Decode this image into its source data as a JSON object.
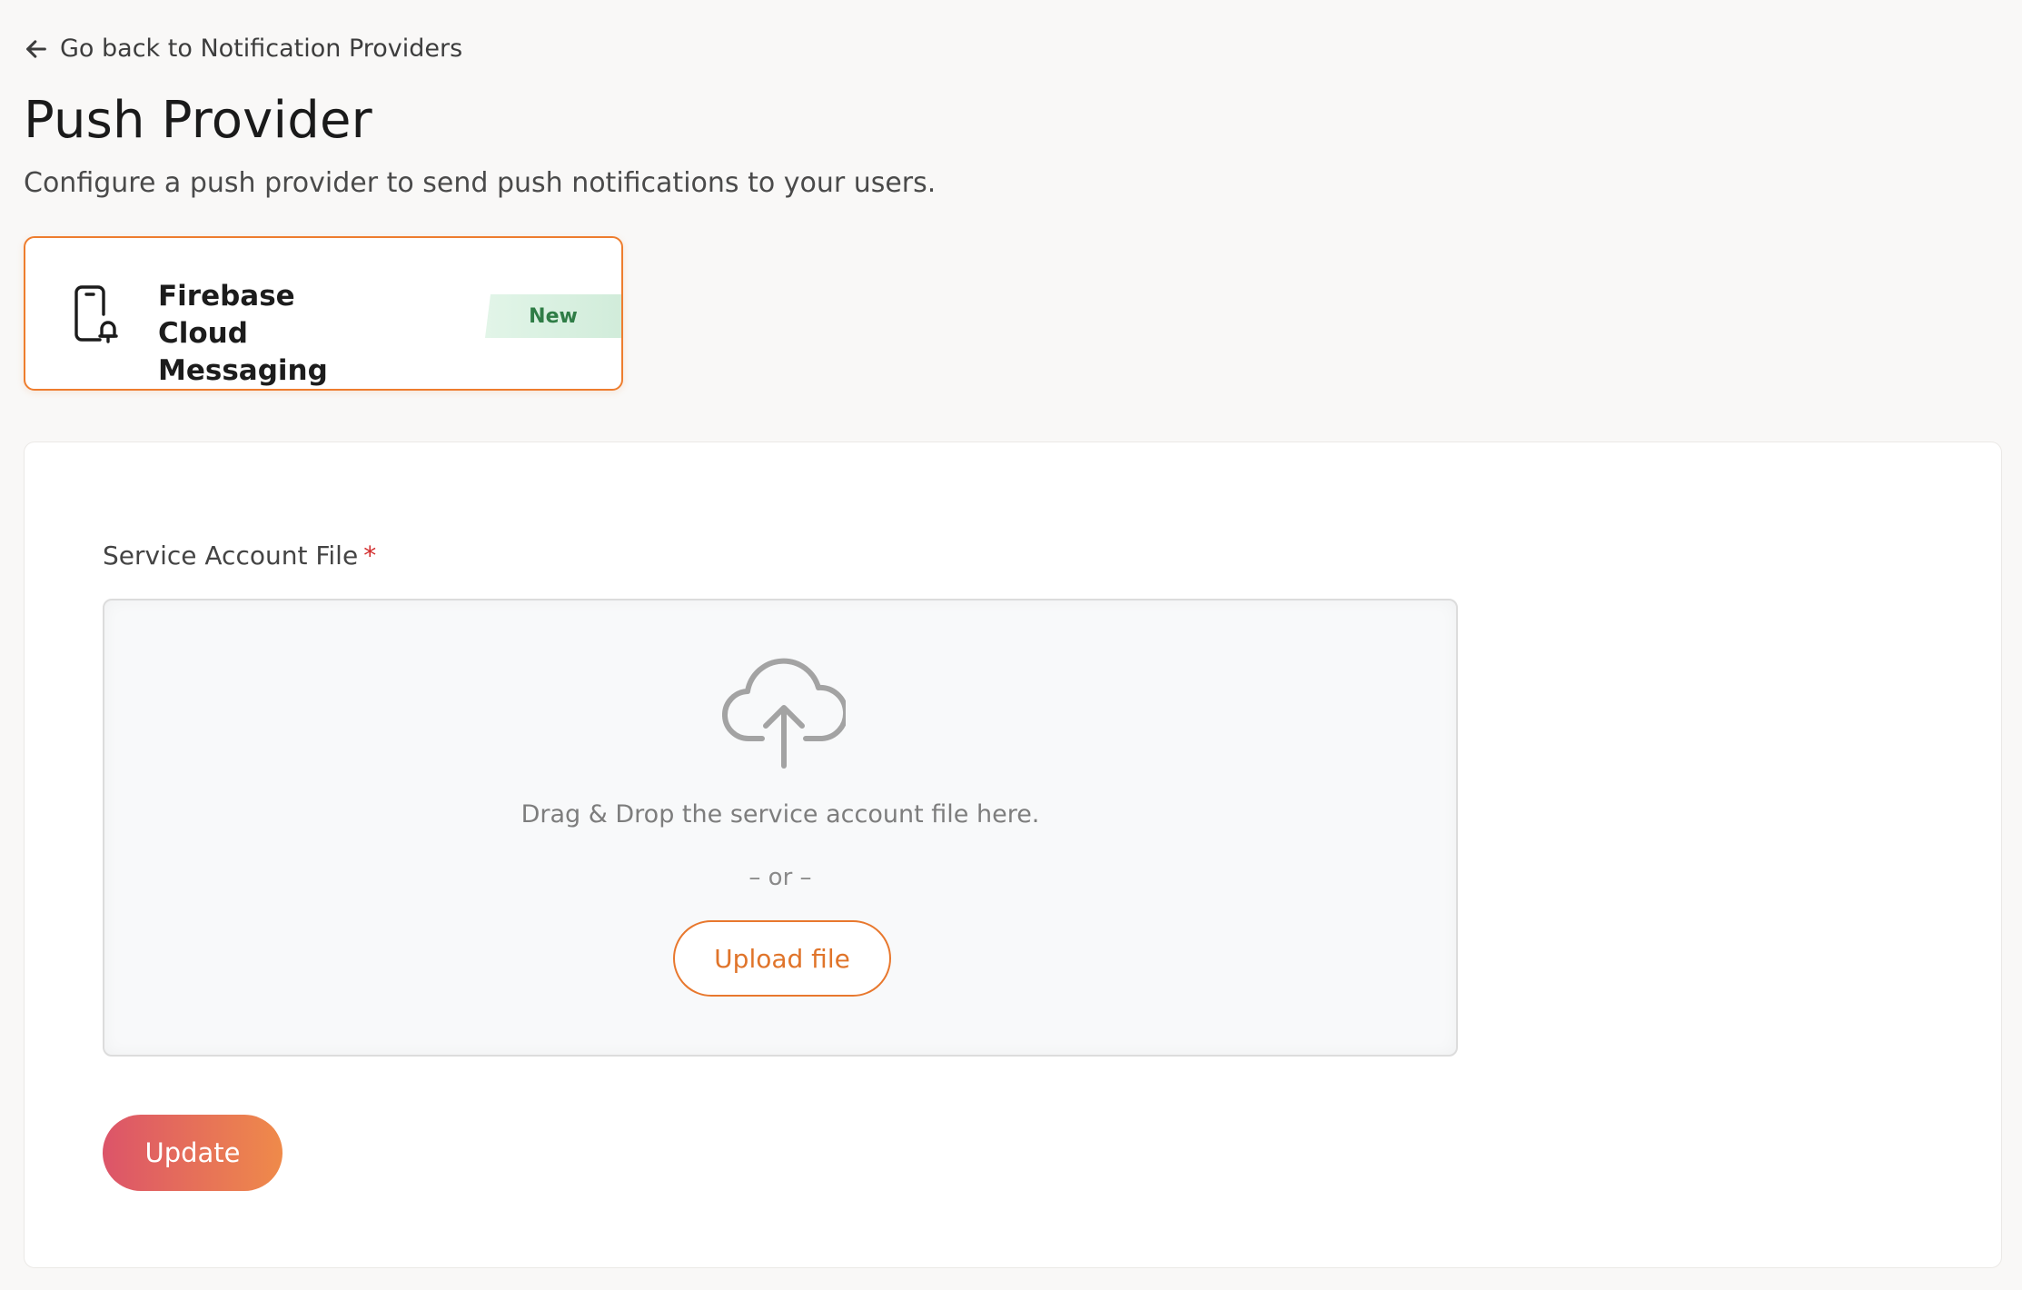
{
  "nav": {
    "back_label": "Go back to Notification Providers"
  },
  "header": {
    "title": "Push Provider",
    "subtitle": "Configure a push provider to send push notifications to your users."
  },
  "provider": {
    "name": "Firebase Cloud Messaging",
    "badge": "New",
    "icon": "phone-bell-icon",
    "selected": true
  },
  "form": {
    "field_label": "Service Account File",
    "required_mark": "*",
    "dropzone": {
      "icon": "cloud-upload-icon",
      "instruction": "Drag & Drop the service account file here.",
      "or_text": "– or –",
      "upload_label": "Upload file"
    },
    "submit_label": "Update"
  },
  "colors": {
    "accent": "#ee7d2e",
    "badge_text": "#2f7d46",
    "required": "#d22d2d",
    "gradient_start": "#dc5469",
    "gradient_end": "#ef8a4a"
  }
}
